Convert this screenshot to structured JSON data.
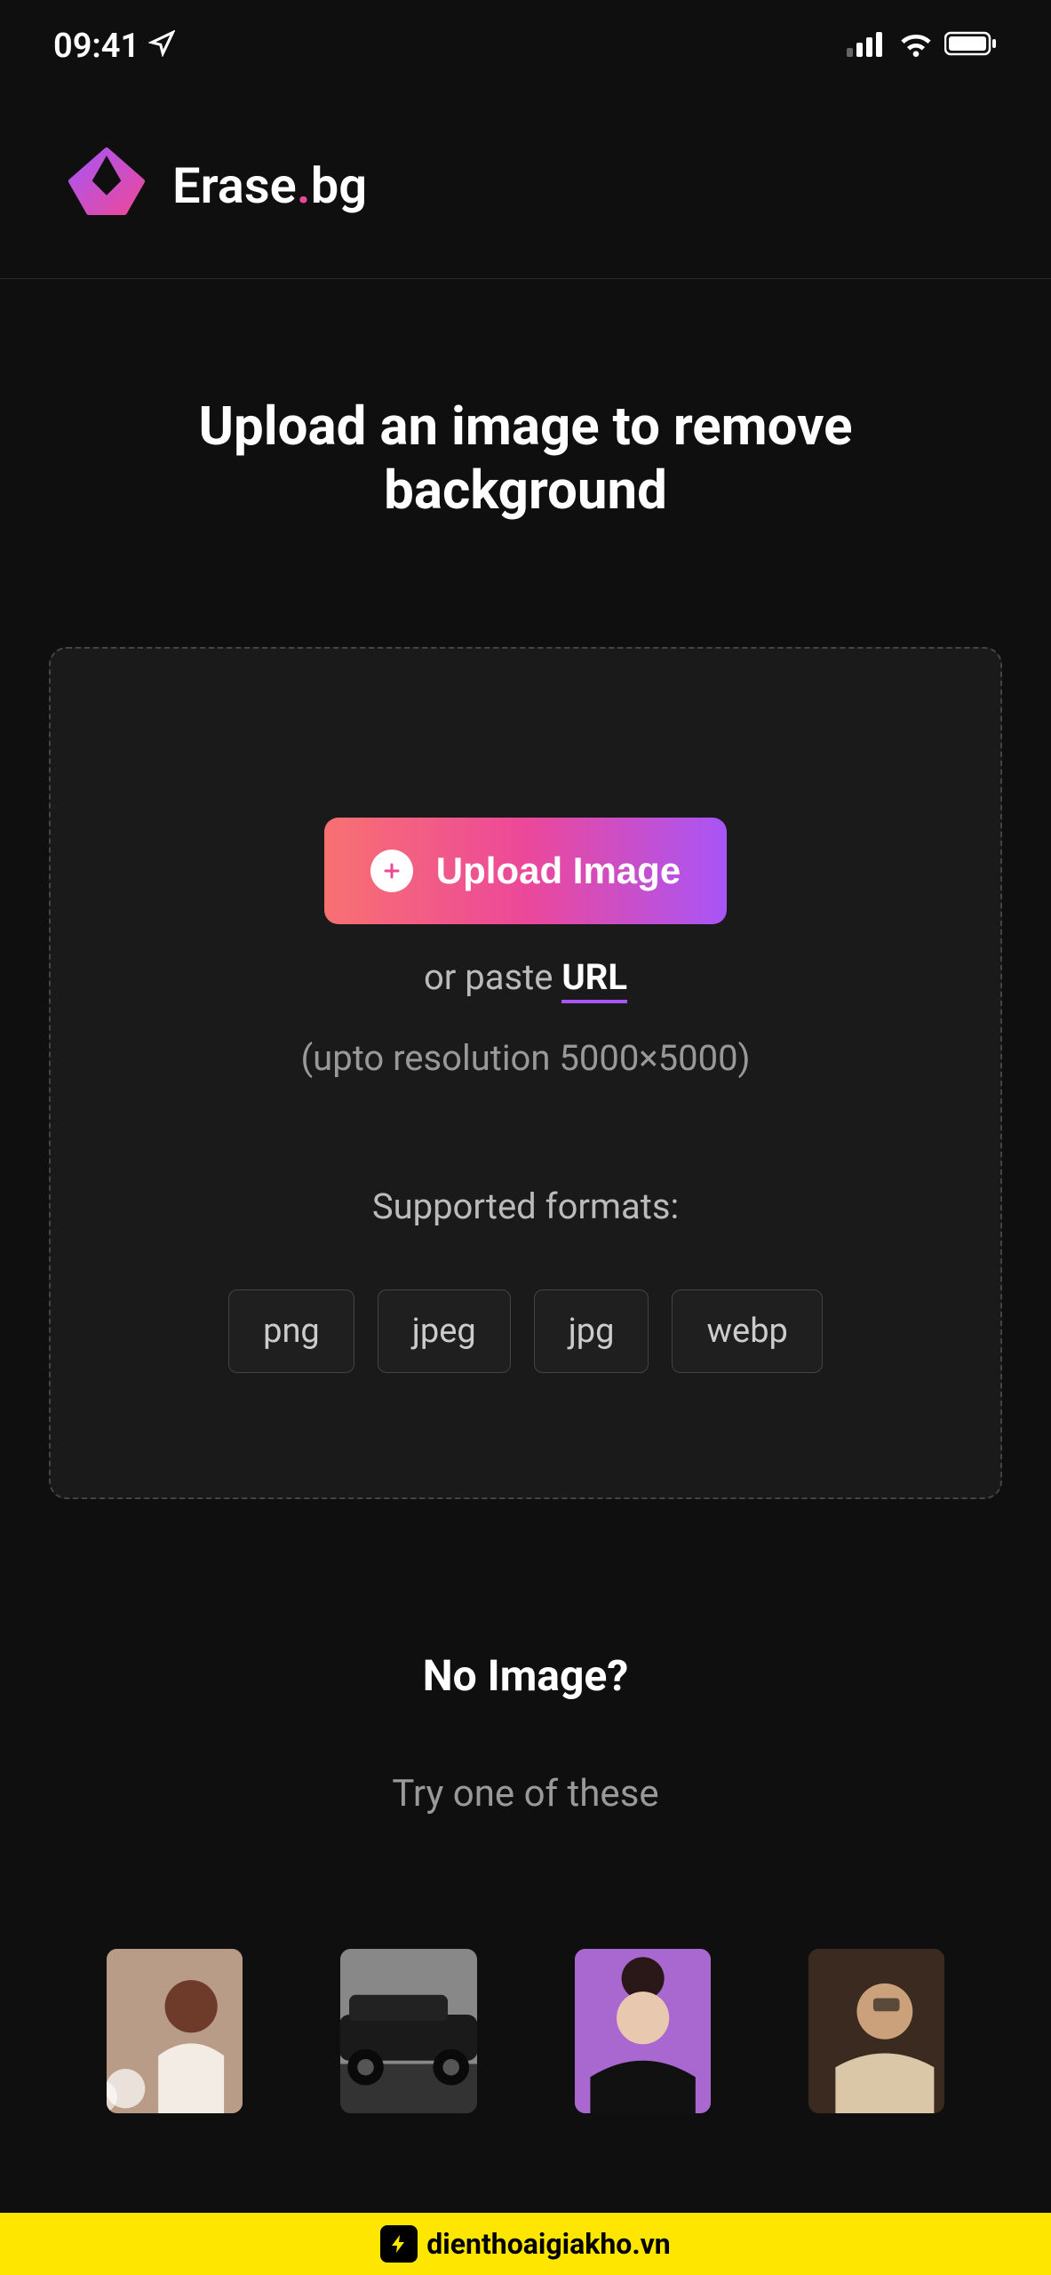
{
  "status_bar": {
    "time": "09:41"
  },
  "header": {
    "logo_text_1": "Erase",
    "logo_text_dot": ".",
    "logo_text_2": "bg"
  },
  "main": {
    "title": "Upload an image to remove background",
    "upload_button_label": "Upload Image",
    "paste_prefix": "or paste ",
    "paste_url_label": "URL",
    "resolution_note": "(upto resolution 5000×5000)",
    "formats_label": "Supported formats:",
    "formats": [
      "png",
      "jpeg",
      "jpg",
      "webp"
    ]
  },
  "no_image": {
    "title": "No Image?",
    "try_text": "Try one of these"
  },
  "samples": [
    "sample-1",
    "sample-2",
    "sample-3",
    "sample-4"
  ],
  "watermark": {
    "text": "dienthoaigiakho.vn"
  }
}
